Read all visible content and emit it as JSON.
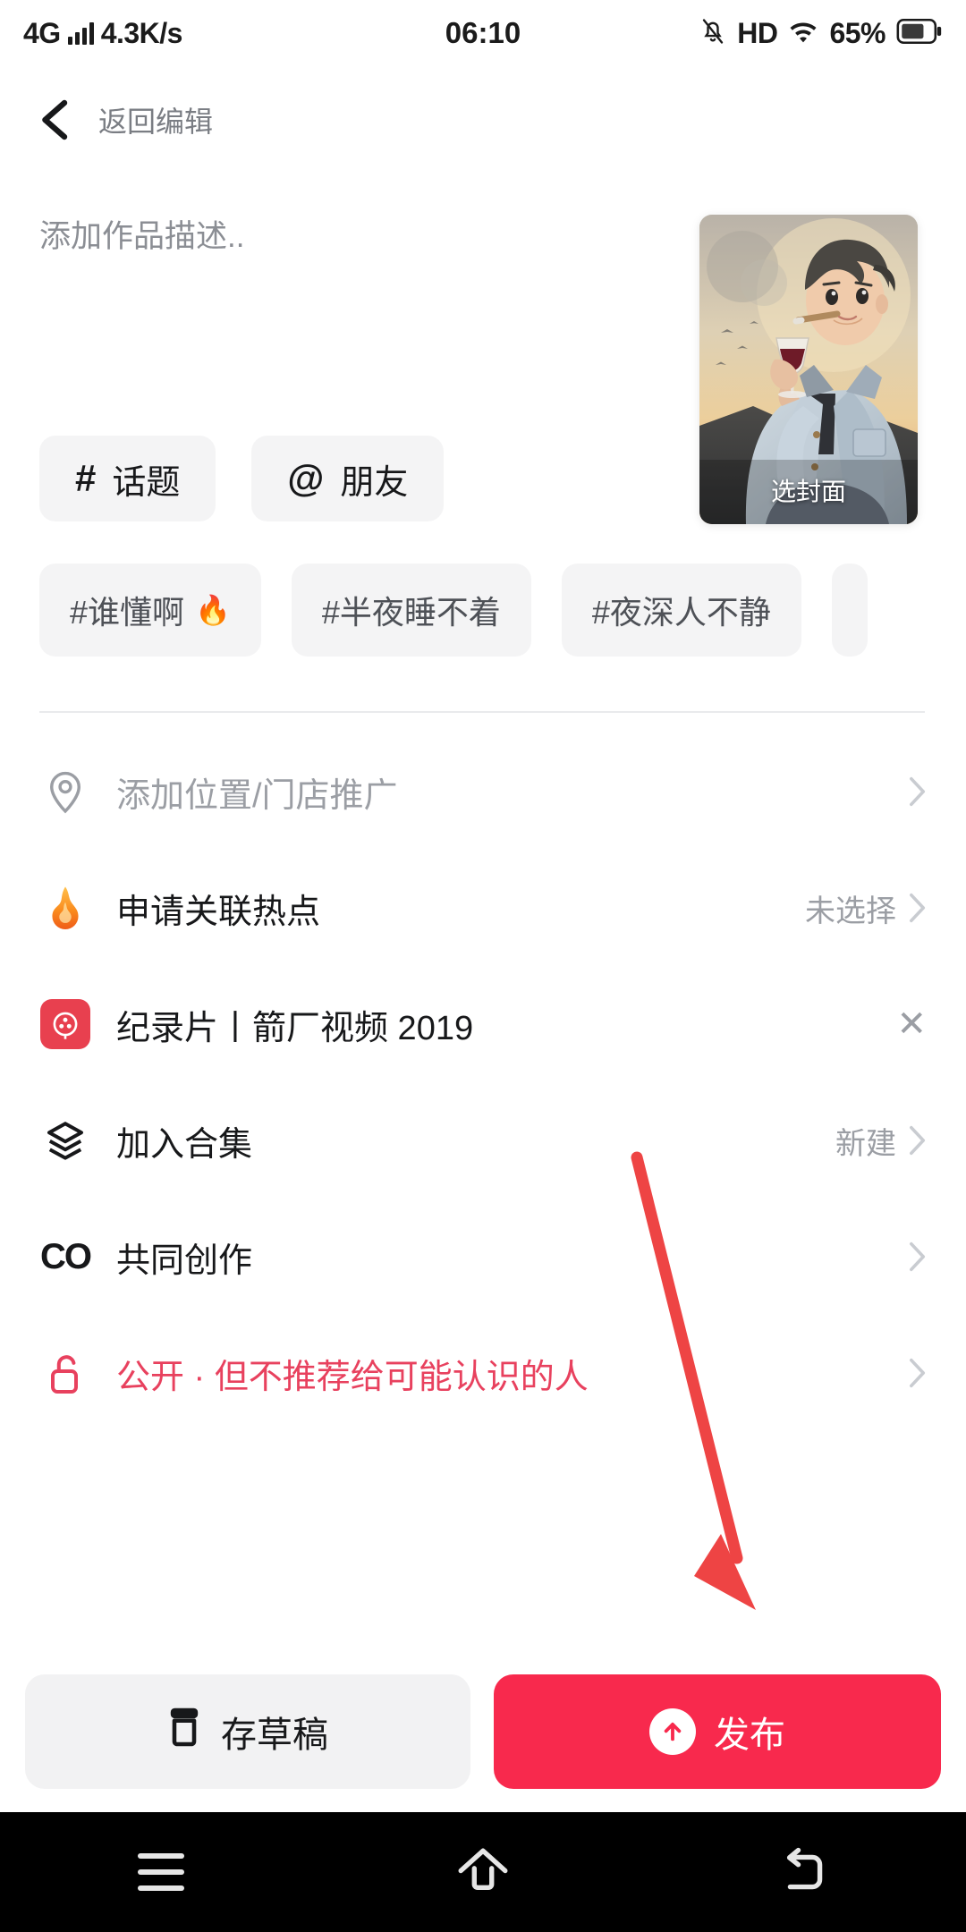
{
  "statusbar": {
    "network": "4G",
    "speed": "4.3K/s",
    "time": "06:10",
    "hd": "HD",
    "battery": "65%",
    "icons": [
      "signal-bars-icon",
      "mute-bell-icon",
      "hd-icon",
      "wifi-icon",
      "battery-icon"
    ]
  },
  "header": {
    "back_label": "返回编辑"
  },
  "description": {
    "placeholder": "添加作品描述..",
    "value": ""
  },
  "cover": {
    "label": "选封面"
  },
  "pills": [
    {
      "glyph": "#",
      "label": "话题",
      "name": "topic"
    },
    {
      "glyph": "@",
      "label": "朋友",
      "name": "friend"
    }
  ],
  "hashtag_chips": [
    {
      "label": "#谁懂啊",
      "flame": "🔥"
    },
    {
      "label": "#半夜睡不着",
      "flame": ""
    },
    {
      "label": "#夜深人不静",
      "flame": ""
    }
  ],
  "rows": {
    "location": {
      "label": "添加位置/门店推广",
      "value": ""
    },
    "hotspot": {
      "label": "申请关联热点",
      "value": "未选择"
    },
    "documentary": {
      "label": "纪录片丨箭厂视频 2019"
    },
    "collection": {
      "label": "加入合集",
      "value": "新建"
    },
    "cocreate": {
      "label": "共同创作",
      "glyph": "CO",
      "value": ""
    },
    "privacy": {
      "label": "公开 · 但不推荐给可能认识的人",
      "value": ""
    }
  },
  "actions": {
    "draft_label": "存草稿",
    "publish_label": "发布"
  },
  "navbar": {
    "recents": "recents-icon",
    "home": "home-icon",
    "back": "back-icon"
  },
  "colors": {
    "accent_red": "#f8294d",
    "privacy_red": "#e8415e",
    "film_red": "#e8404f",
    "annotation_red": "#ee4444",
    "chip_bg": "#f4f4f5",
    "muted_text": "#9b9ea4"
  }
}
